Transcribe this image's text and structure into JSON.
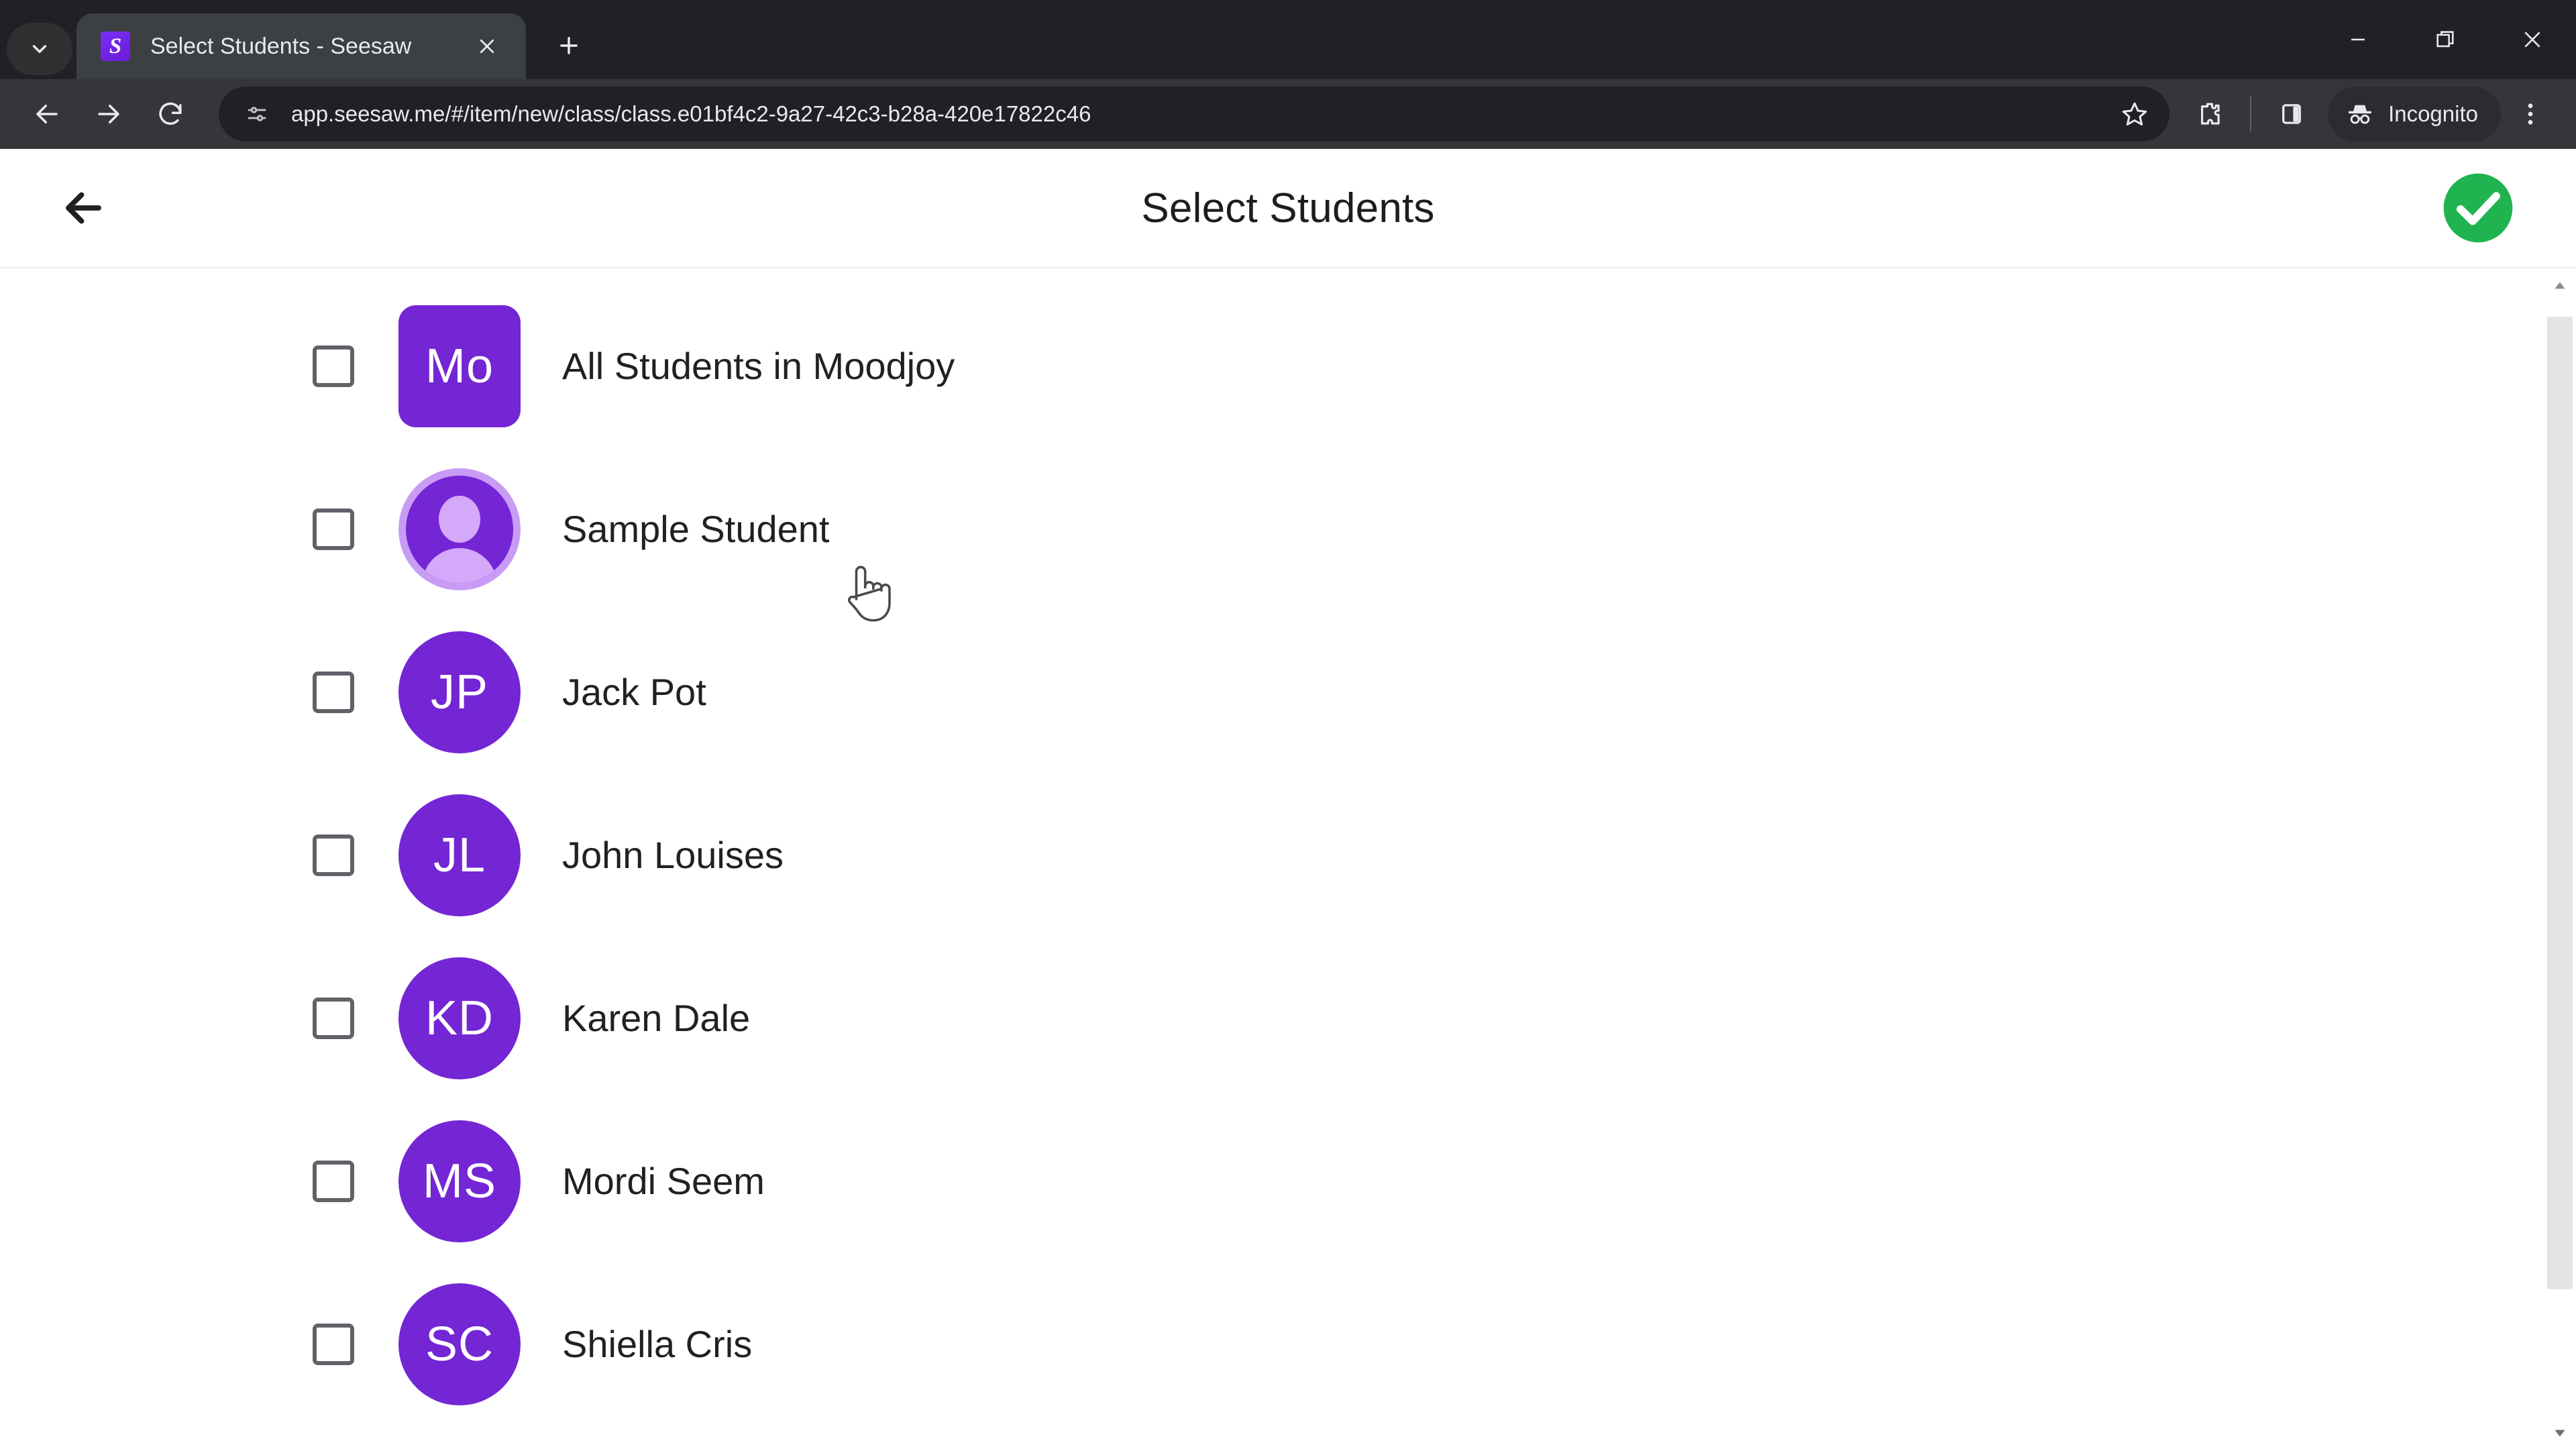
{
  "browser": {
    "tab": {
      "title": "Select Students - Seesaw",
      "favicon_letter": "S",
      "favicon_color": "#7b2ff7"
    },
    "tab_search_icon": "chevron-down-icon",
    "new_tab_icon": "plus-icon",
    "window_controls": {
      "minimize": "minimize-icon",
      "maximize": "restore-icon",
      "close": "close-icon"
    },
    "nav": {
      "back": "back-arrow-icon",
      "forward": "forward-arrow-icon",
      "reload": "reload-icon"
    },
    "omnibox": {
      "site_info_icon": "site-settings-icon",
      "url": "app.seesaw.me/#/item/new/class/class.e01bf4c2-9a27-42c3-b28a-420e17822c46",
      "bookmark_icon": "star-icon"
    },
    "toolbar": {
      "extensions_icon": "extensions-puzzle-icon",
      "side_panel_icon": "side-panel-icon",
      "incognito_label": "Incognito",
      "incognito_icon": "incognito-hat-icon",
      "menu_icon": "kebab-menu-icon"
    }
  },
  "page": {
    "back_icon": "back-arrow-icon",
    "title": "Select Students",
    "confirm_icon": "green-check-circle-icon",
    "confirm_color": "#21b34f",
    "avatar_color": "#7425d4",
    "students": [
      {
        "initials": "Mo",
        "name": "All Students in Moodjoy",
        "avatar_type": "square",
        "checked": false
      },
      {
        "initials": "",
        "name": "Sample Student",
        "avatar_type": "person",
        "checked": false
      },
      {
        "initials": "JP",
        "name": "Jack Pot",
        "avatar_type": "initials",
        "checked": false
      },
      {
        "initials": "JL",
        "name": "John Louises",
        "avatar_type": "initials",
        "checked": false
      },
      {
        "initials": "KD",
        "name": "Karen Dale",
        "avatar_type": "initials",
        "checked": false
      },
      {
        "initials": "MS",
        "name": "Mordi Seem",
        "avatar_type": "initials",
        "checked": false
      },
      {
        "initials": "SC",
        "name": "Shiella Cris",
        "avatar_type": "initials",
        "checked": false
      }
    ]
  }
}
